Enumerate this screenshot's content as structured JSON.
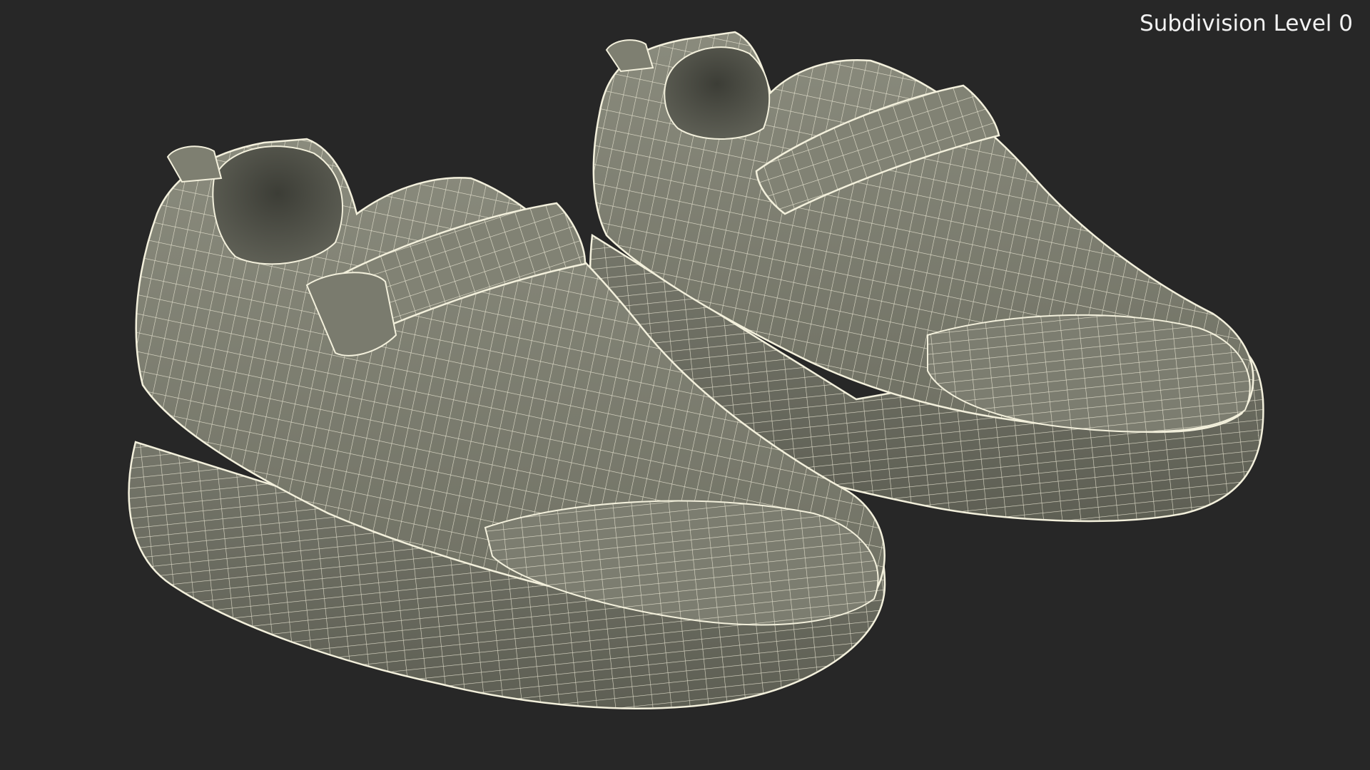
{
  "overlay": {
    "subdivision_label": "Subdivision Level 0"
  },
  "scene": {
    "background_color": "#272727",
    "surface_color": "#7a7b6d",
    "wire_color": "#f3f0dc",
    "objects": [
      "left-shoe",
      "right-shoe"
    ]
  }
}
